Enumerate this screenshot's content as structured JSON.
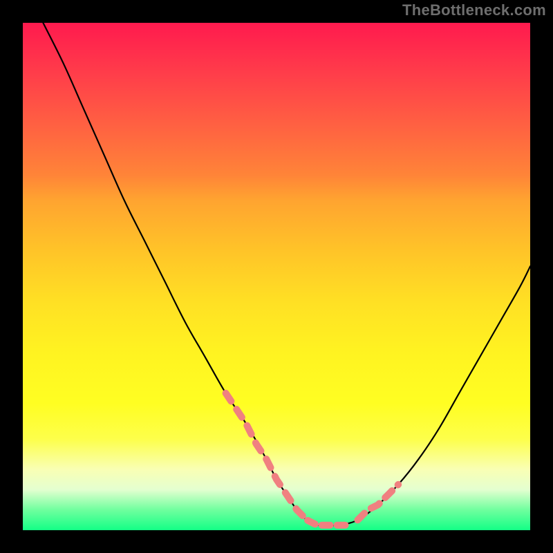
{
  "watermark": "TheBottleneck.com",
  "chart_data": {
    "type": "line",
    "title": "",
    "xlabel": "",
    "ylabel": "",
    "xlim": [
      0,
      100
    ],
    "ylim": [
      0,
      100
    ],
    "grid": false,
    "series": [
      {
        "name": "black-curve",
        "color": "#000000",
        "x": [
          4,
          8,
          12,
          16,
          20,
          24,
          28,
          32,
          36,
          40,
          44,
          48,
          50,
          52,
          54,
          56,
          58,
          62,
          66,
          70,
          74,
          78,
          82,
          86,
          90,
          94,
          98,
          100
        ],
        "values": [
          100,
          92,
          83,
          74,
          65,
          57,
          49,
          41,
          34,
          27,
          21,
          14,
          10,
          7,
          4,
          2,
          1,
          1,
          2,
          5,
          9,
          14,
          20,
          27,
          34,
          41,
          48,
          52
        ]
      },
      {
        "name": "coral-segment-left",
        "color": "#f08080",
        "x": [
          40,
          42,
          44,
          46,
          48,
          50,
          52,
          54
        ],
        "values": [
          27,
          24,
          21,
          17,
          14,
          10,
          7,
          4
        ]
      },
      {
        "name": "coral-segment-bottom",
        "color": "#f08080",
        "x": [
          54,
          56,
          58,
          62,
          64
        ],
        "values": [
          4,
          2,
          1,
          1,
          1
        ]
      },
      {
        "name": "coral-segment-right",
        "color": "#f08080",
        "x": [
          66,
          68,
          70,
          72,
          74
        ],
        "values": [
          2,
          4,
          5,
          7,
          9
        ]
      }
    ]
  }
}
